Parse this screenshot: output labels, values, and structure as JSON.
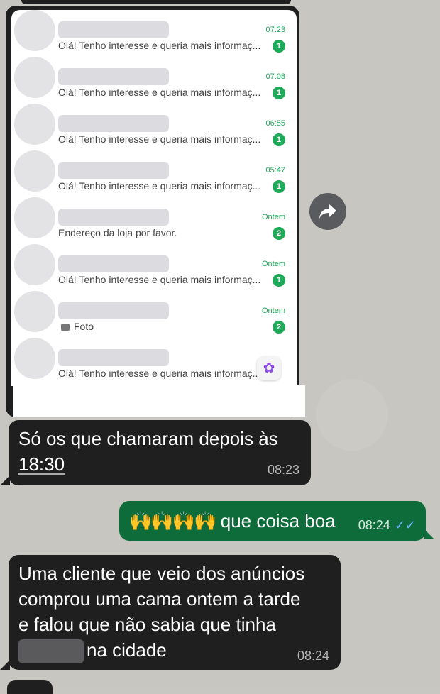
{
  "screenshot_chats": [
    {
      "preview": "Olá! Tenho interesse e queria mais informaç...",
      "time": "07:23",
      "badge": "1"
    },
    {
      "preview": "Olá! Tenho interesse e queria mais informaç...",
      "time": "07:08",
      "badge": "1"
    },
    {
      "preview": "Olá! Tenho interesse e queria mais informaç...",
      "time": "06:55",
      "badge": "1"
    },
    {
      "preview": "Olá! Tenho interesse e queria mais informaç...",
      "time": "05:47",
      "badge": "1"
    },
    {
      "preview": "Endereço da loja por favor.",
      "time": "Ontem",
      "badge": "2"
    },
    {
      "preview": "Olá! Tenho interesse e queria mais informaç...",
      "time": "Ontem",
      "badge": "1"
    },
    {
      "preview": "Foto",
      "time": "Ontem",
      "badge": "2"
    },
    {
      "preview": "Olá! Tenho interesse e queria mais informaç...",
      "time": "",
      "badge": ""
    }
  ],
  "messages": {
    "m1": {
      "line1": "Só os que chamaram depois às",
      "line2": "18:30",
      "time": "08:23"
    },
    "m2": {
      "emoji": "🙌🙌🙌🙌",
      "text": "que coisa boa",
      "time": "08:24"
    },
    "m3": {
      "line1": "Uma cliente que veio dos anúncios",
      "line2": "comprou uma cama ontem a tarde",
      "line3": "e falou que não sabia que tinha",
      "line4": "na cidade",
      "time": "08:24"
    }
  },
  "colors": {
    "received_bubble": "#1f1f1f",
    "sent_bubble": "#0e6b3a",
    "accent_green": "#1faa59",
    "read_ticks": "#6fb6ff"
  },
  "icons": {
    "forward": "forward-arrow-icon",
    "photo": "photo-icon",
    "read": "double-check-icon"
  }
}
